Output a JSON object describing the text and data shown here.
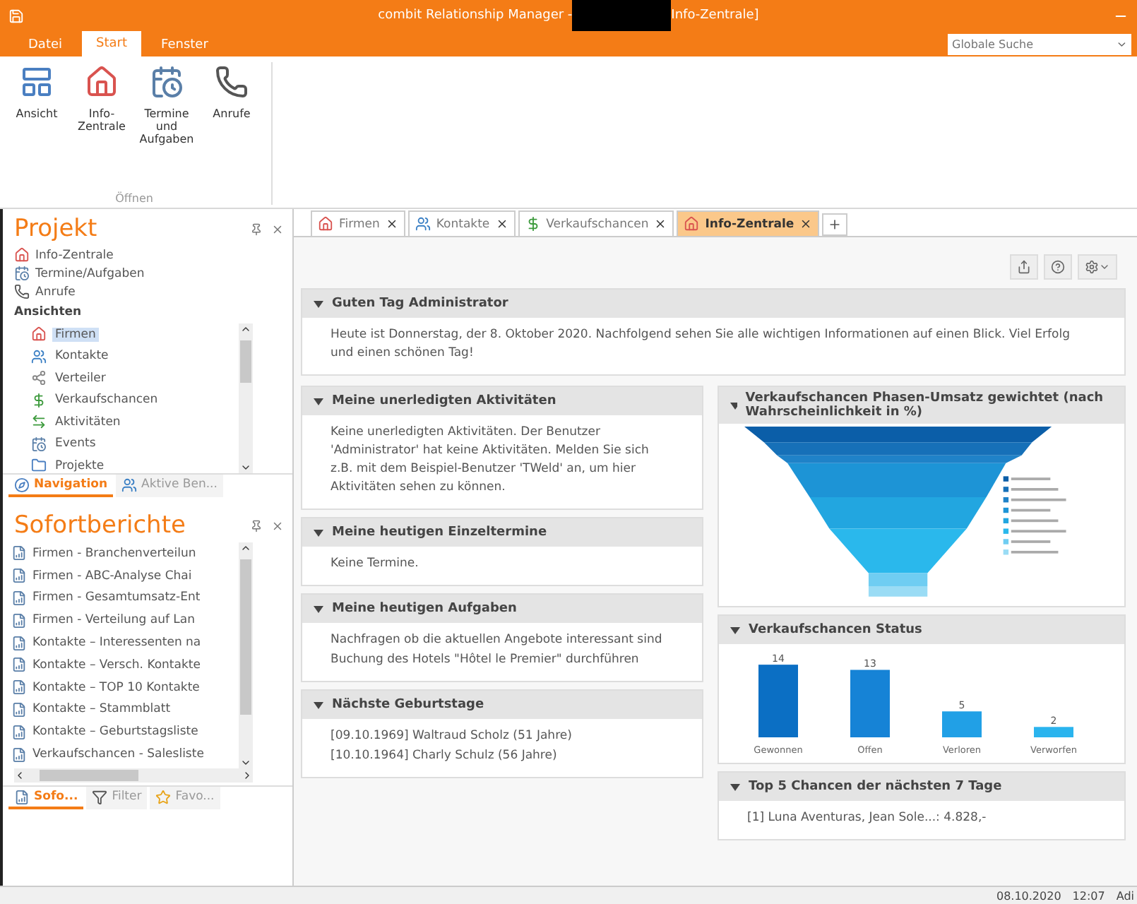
{
  "window": {
    "title_left": "combit Relationship Manager - ",
    "title_right": "Info-Zentrale]"
  },
  "menu_tabs": [
    {
      "label": "Datei",
      "selected": false
    },
    {
      "label": "Start",
      "selected": true
    },
    {
      "label": "Fenster",
      "selected": false
    }
  ],
  "search": {
    "placeholder": "Globale Suche"
  },
  "ribbon": {
    "group_label": "Öffnen",
    "buttons": [
      {
        "label": "Ansicht",
        "kind": "view"
      },
      {
        "label": "Info-Zentrale",
        "kind": "home"
      },
      {
        "label": "Termine und Aufgaben",
        "kind": "calendar"
      },
      {
        "label": "Anrufe",
        "kind": "phone"
      }
    ]
  },
  "project_panel": {
    "title": "Projekt",
    "links": [
      {
        "label": "Info-Zentrale",
        "kind": "home"
      },
      {
        "label": "Termine/Aufgaben",
        "kind": "calendar"
      },
      {
        "label": "Anrufe",
        "kind": "phone"
      }
    ],
    "section_label": "Ansichten",
    "views": [
      {
        "label": "Firmen",
        "kind": "home",
        "selected": true
      },
      {
        "label": "Kontakte",
        "kind": "users",
        "selected": false
      },
      {
        "label": "Verteiler",
        "kind": "share",
        "selected": false
      },
      {
        "label": "Verkaufschancen",
        "kind": "money",
        "selected": false
      },
      {
        "label": "Aktivitäten",
        "kind": "arrows",
        "selected": false
      },
      {
        "label": "Events",
        "kind": "calendar",
        "selected": false
      },
      {
        "label": "Projekte",
        "kind": "folder",
        "selected": false
      }
    ],
    "tabs": [
      {
        "label": "Navigation",
        "kind": "nav",
        "selected": true
      },
      {
        "label": "Aktive Ben...",
        "kind": "users",
        "selected": false
      }
    ]
  },
  "reports_panel": {
    "title": "Sofortberichte",
    "items": [
      "Firmen - Branchenverteilun",
      "Firmen - ABC-Analyse Chai",
      "Firmen - Gesamtumsatz-Ent",
      "Firmen - Verteilung auf Lan",
      "Kontakte – Interessenten na",
      "Kontakte – Versch. Kontakte",
      "Kontakte – TOP 10 Kontakte",
      "Kontakte – Stammblatt",
      "Kontakte – Geburtstagsliste",
      "Verkaufschancen - Salesliste"
    ],
    "tabs": [
      {
        "label": "Sofo...",
        "kind": "report",
        "selected": true
      },
      {
        "label": "Filter",
        "kind": "filter",
        "selected": false
      },
      {
        "label": "Favo...",
        "kind": "star",
        "selected": false
      }
    ]
  },
  "doc_tabs": [
    {
      "label": "Firmen",
      "kind": "home",
      "selected": false
    },
    {
      "label": "Kontakte",
      "kind": "users",
      "selected": false
    },
    {
      "label": "Verkaufschancen",
      "kind": "money",
      "selected": false
    },
    {
      "label": "Info-Zentrale",
      "kind": "home",
      "selected": true
    }
  ],
  "welcome": {
    "title": "Guten Tag Administrator",
    "text": "Heute ist Donnerstag, der 8. Oktober 2020. Nachfolgend sehen Sie alle wichtigen Informationen auf einen Blick. Viel Erfolg und einen schönen Tag!"
  },
  "activities": {
    "title": "Meine unerledigten Aktivitäten",
    "text": "Keine unerledigten Aktivitäten. Der Benutzer 'Administrator' hat keine Aktivitäten. Melden Sie sich z.B. mit dem Beispiel-Benutzer 'TWeld' an, um hier Aktivitäten sehen zu können."
  },
  "appointments": {
    "title": "Meine heutigen Einzeltermine",
    "text": "Keine Termine."
  },
  "tasks": {
    "title": "Meine heutigen Aufgaben",
    "items": [
      "Nachfragen ob die aktuellen Angebote interessant sind",
      "Buchung des Hotels \"Hôtel le Premier\" durchführen"
    ]
  },
  "birthdays": {
    "title": "Nächste Geburtstage",
    "items": [
      "[09.10.1969] Waltraud Scholz (51 Jahre)",
      "[10.10.1964] Charly Schulz (56 Jahre)"
    ]
  },
  "funnel": {
    "title": "Verkaufschancen Phasen-Umsatz gewichtet (nach Wahrscheinlichkeit in %)"
  },
  "status_chart": {
    "title": "Verkaufschancen Status",
    "chart_data": {
      "type": "bar",
      "categories": [
        "Gewonnen",
        "Offen",
        "Verloren",
        "Verworfen"
      ],
      "values": [
        14,
        13,
        5,
        2
      ],
      "data_labels": true
    }
  },
  "top5": {
    "title": "Top 5 Chancen der nächsten 7 Tage",
    "items": [
      "[1] Luna Aventuras, Jean Sole...: 4.828,-"
    ]
  },
  "status_bar": {
    "date": "08.10.2020",
    "time": "12:07",
    "user": "Adi"
  }
}
